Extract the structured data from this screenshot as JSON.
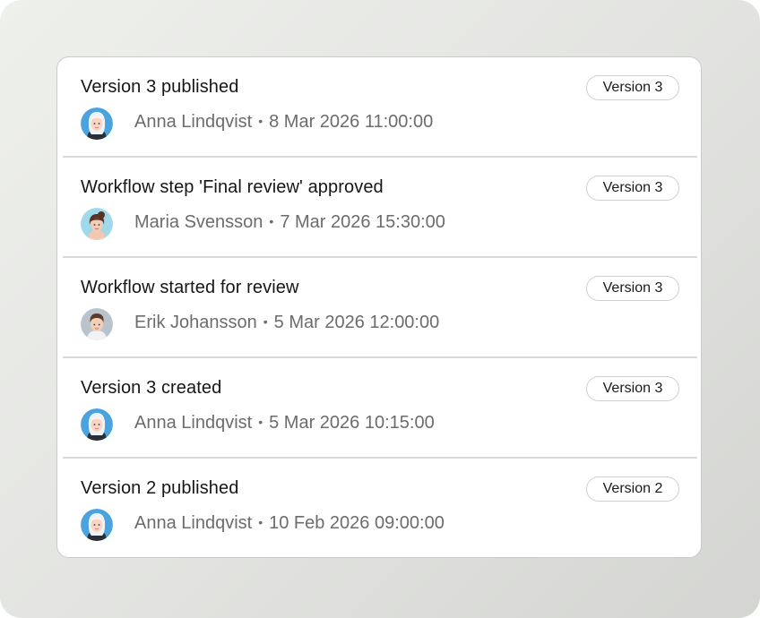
{
  "activity": {
    "entries": [
      {
        "title": "Version 3 published",
        "badge": "Version 3",
        "user": "Anna Lindqvist",
        "separator": "•",
        "timestamp": "8 Mar 2026 11:00:00",
        "avatar_icon": "avatar-anna-icon"
      },
      {
        "title": "Workflow step 'Final review' approved",
        "badge": "Version 3",
        "user": "Maria Svensson",
        "separator": "•",
        "timestamp": "7 Mar 2026 15:30:00",
        "avatar_icon": "avatar-maria-icon"
      },
      {
        "title": "Workflow started for review",
        "badge": "Version 3",
        "user": "Erik Johansson",
        "separator": "•",
        "timestamp": "5 Mar 2026 12:00:00",
        "avatar_icon": "avatar-erik-icon"
      },
      {
        "title": "Version 3 created",
        "badge": "Version 3",
        "user": "Anna Lindqvist",
        "separator": "•",
        "timestamp": "5 Mar 2026 10:15:00",
        "avatar_icon": "avatar-anna-icon"
      },
      {
        "title": "Version 2 published",
        "badge": "Version 2",
        "user": "Anna Lindqvist",
        "separator": "•",
        "timestamp": "10 Feb 2026 09:00:00",
        "avatar_icon": "avatar-anna-icon"
      }
    ]
  },
  "colors": {
    "title": "#161616",
    "meta": "#6c6c6c",
    "badge_border": "#cfd0cd",
    "divider": "#d9dad8",
    "avatar_anna_bg": "#4aa3df",
    "avatar_maria_bg": "#9fd9ea",
    "avatar_erik_bg": "#b9c3cc"
  }
}
